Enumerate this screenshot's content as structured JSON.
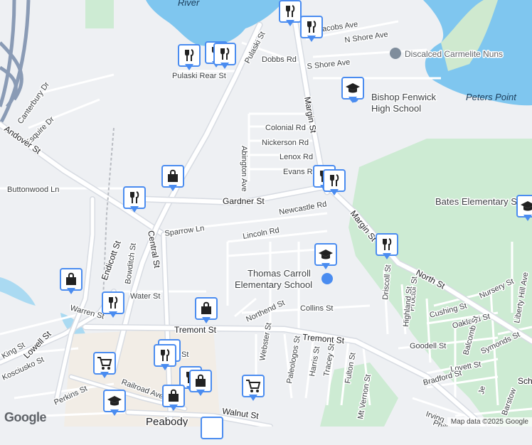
{
  "map": {
    "labels": {
      "river": "River",
      "pulaski_st": "Pulaski St",
      "pulaski_rear_st": "Pulaski Rear St",
      "jacobs_ave": "Jacobs Ave",
      "n_shore_ave": "N Shore Ave",
      "s_shore_ave": "S Shore Ave",
      "dobbs_rd": "Dobbs Rd",
      "canterbury_dr": "Canterbury Dr",
      "esquire_dr": "Esquire Dr",
      "andover_st": "Andover St",
      "buttonwood_ln": "Buttonwood Ln",
      "colonial_rd": "Colonial Rd",
      "nickerson_rd": "Nickerson Rd",
      "lenox_rd": "Lenox Rd",
      "evans_rd": "Evans Rd",
      "abington_ave": "Abington Ave",
      "gardner_st": "Gardner St",
      "newcastle_rd": "Newcastle Rd",
      "margin_st_top": "Margin St",
      "margin_st_lower": "Margin St",
      "sparrow_ln": "Sparrow Ln",
      "lincoln_rd": "Lincoln Rd",
      "endicott_st": "Endicott St",
      "central_st": "Central St",
      "bowditch_st": "Bowditch St",
      "water_st": "Water St",
      "warren_st": "Warren St",
      "tremont_st_left": "Tremont St",
      "tremont_st_right": "Tremont St",
      "northend_st": "Northend St",
      "collins_st": "Collins St",
      "webster_st": "Webster St",
      "paleologos_st": "Paleologos St",
      "harris_st": "Harris St",
      "tracey_st": "Tracey St",
      "fulton_st": "Fulton St",
      "mt_vernon_st": "Mt Vernon St",
      "driscoll_st": "Driscoll St",
      "proctor_st": "Proctor St",
      "highland_st": "Highland St",
      "north_st": "North St",
      "cushing_st": "Cushing St",
      "oakland_st": "Oakland St",
      "goodell_st": "Goodell St",
      "balcomb_st": "Balcomb St",
      "lovett_st": "Lovett St",
      "bradford_st": "Bradford St",
      "symonds_st": "Symonds St",
      "nursery_st": "Nursery St",
      "liberty_hill_ave": "Liberty Hill Ave",
      "lowell_st": "Lowell St",
      "king_st": "King St",
      "kosciusko_st": "Kosciusko St",
      "perkins_st": "Perkins St",
      "railroad_ave": "Railroad Ave",
      "walnut_st": "Walnut St",
      "peabody": "Peabody",
      "irving": "Irving",
      "phillips": "Phillips",
      "barstow": "Barstow",
      "jeff": "Je",
      "sch": "Sch",
      "st_top": "St",
      "st_bottom": "St"
    },
    "pois": {
      "carmelite_nuns": "Discalced Carmelite Nuns",
      "bishop_fenwick_1": "Bishop Fenwick",
      "bishop_fenwick_2": "High School",
      "peters_point": "Peters Point",
      "bates_elementary": "Bates Elementary S",
      "thomas_carroll_1": "Thomas Carroll",
      "thomas_carroll_2": "Elementary School"
    },
    "attribution": "Map data ©2025 Google",
    "google_logo": "Google"
  }
}
